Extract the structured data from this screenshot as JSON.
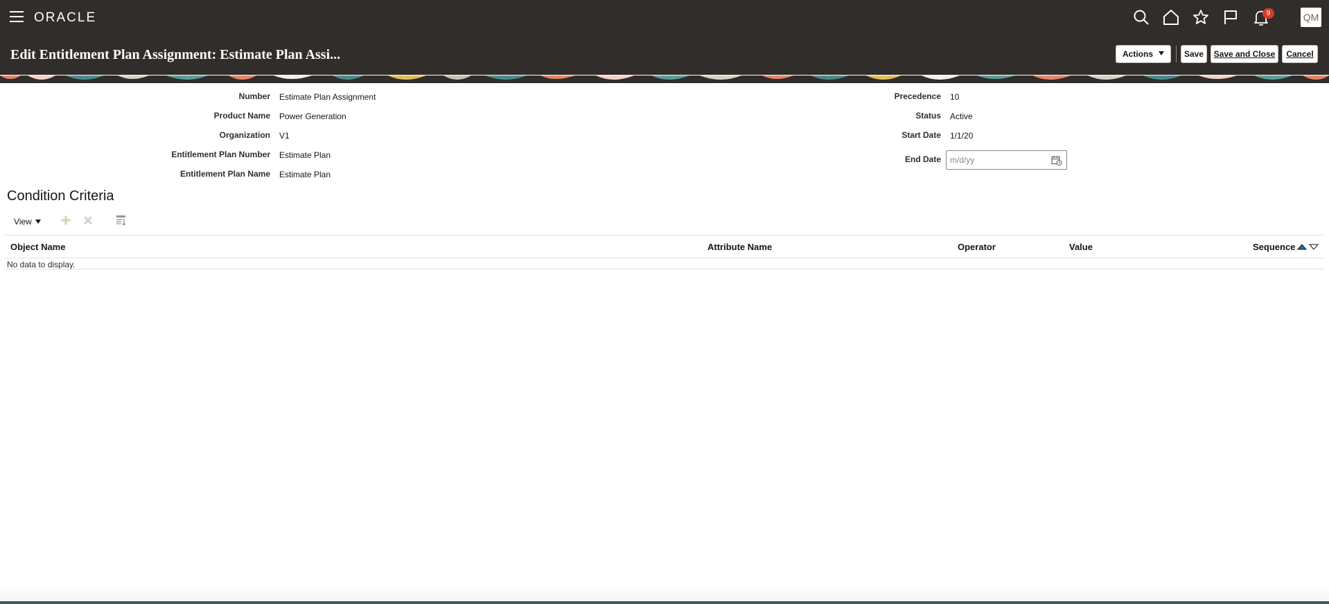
{
  "header": {
    "logo": "ORACLE",
    "notification_count": "9",
    "user_initials": "QM",
    "icons": [
      "menu-icon",
      "search-icon",
      "home-icon",
      "favorites-star-icon",
      "watchlist-flag-icon",
      "notifications-bell-icon"
    ]
  },
  "page": {
    "title": "Edit Entitlement Plan Assignment: Estimate Plan Assi...",
    "actions_label": "Actions",
    "save_label": "Save",
    "save_close_label": "Save and Close",
    "cancel_label": "Cancel"
  },
  "form": {
    "left": [
      {
        "label": "Number",
        "value": "Estimate Plan Assignment"
      },
      {
        "label": "Product Name",
        "value": "Power Generation"
      },
      {
        "label": "Organization",
        "value": "V1"
      },
      {
        "label": "Entitlement Plan Number",
        "value": "Estimate Plan"
      },
      {
        "label": "Entitlement Plan Name",
        "value": "Estimate Plan"
      }
    ],
    "right": [
      {
        "label": "Precedence",
        "value": "10"
      },
      {
        "label": "Status",
        "value": "Active"
      },
      {
        "label": "Start Date",
        "value": "1/1/20"
      }
    ],
    "end_date": {
      "label": "End Date",
      "value": "",
      "placeholder": "m/d/yy"
    }
  },
  "conditions": {
    "title": "Condition Criteria",
    "view_label": "View",
    "columns": [
      "Object Name",
      "Attribute Name",
      "Operator",
      "Value",
      "Sequence"
    ],
    "empty_message": "No data to display."
  },
  "colors": {
    "header_bg": "#312d2a",
    "badge": "#d63b25",
    "sort_up": "#1f6fb2"
  }
}
